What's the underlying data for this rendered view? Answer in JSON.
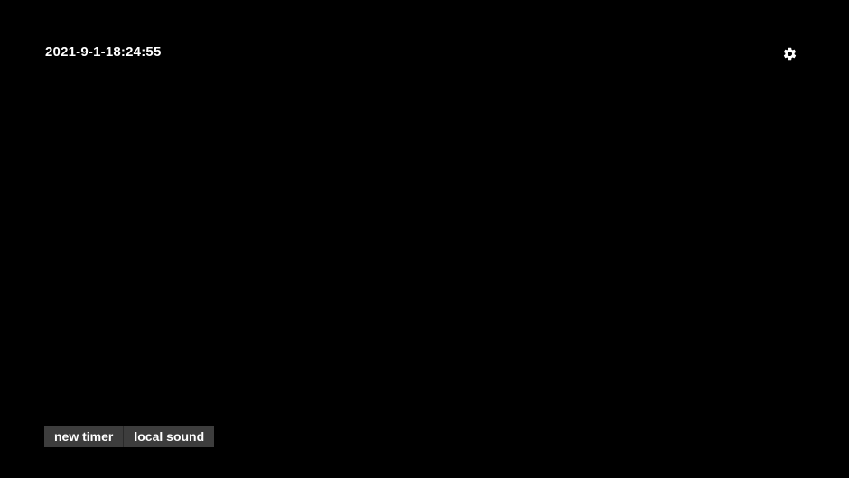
{
  "header": {
    "datetime": "2021-9-1-18:24:55",
    "settings_icon": "gear-icon"
  },
  "toolbar": {
    "new_timer_label": "new timer",
    "local_sound_label": "local sound"
  },
  "colors": {
    "background": "#000000",
    "text": "#ffffff",
    "button_background": "#3d3d3d"
  }
}
